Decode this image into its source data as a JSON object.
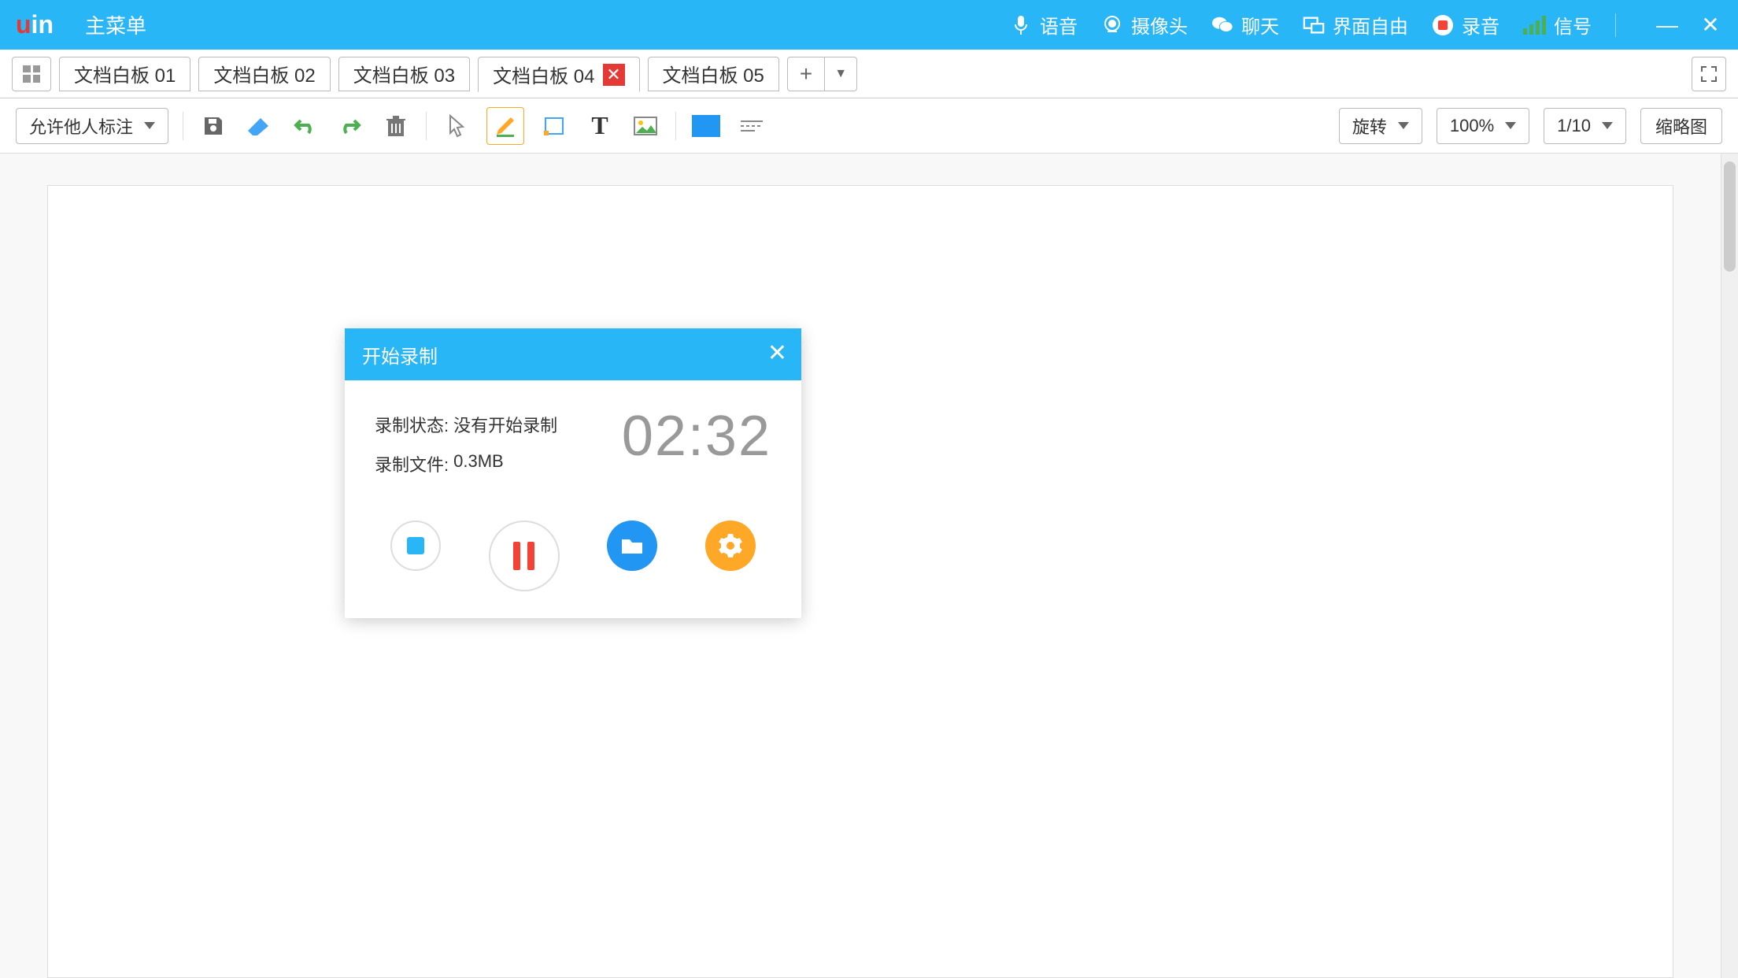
{
  "header": {
    "main_menu": "主菜单",
    "items": {
      "voice": "语音",
      "camera": "摄像头",
      "chat": "聊天",
      "interface": "界面自由",
      "record": "录音",
      "signal": "信号"
    }
  },
  "tabs": [
    {
      "label": "文档白板 01"
    },
    {
      "label": "文档白板 02"
    },
    {
      "label": "文档白板 03"
    },
    {
      "label": "文档白板 04",
      "active": true,
      "closable": true
    },
    {
      "label": "文档白板 05"
    }
  ],
  "toolbar": {
    "annotate_dropdown": "允许他人标注",
    "rotate": "旋转",
    "zoom": "100%",
    "page": "1/10",
    "thumbnail": "缩略图"
  },
  "dialog": {
    "title": "开始录制",
    "status_label": "录制状态:",
    "status_value": "没有开始录制",
    "file_label": "录制文件:",
    "file_value": "0.3MB",
    "timer": "02:32"
  }
}
